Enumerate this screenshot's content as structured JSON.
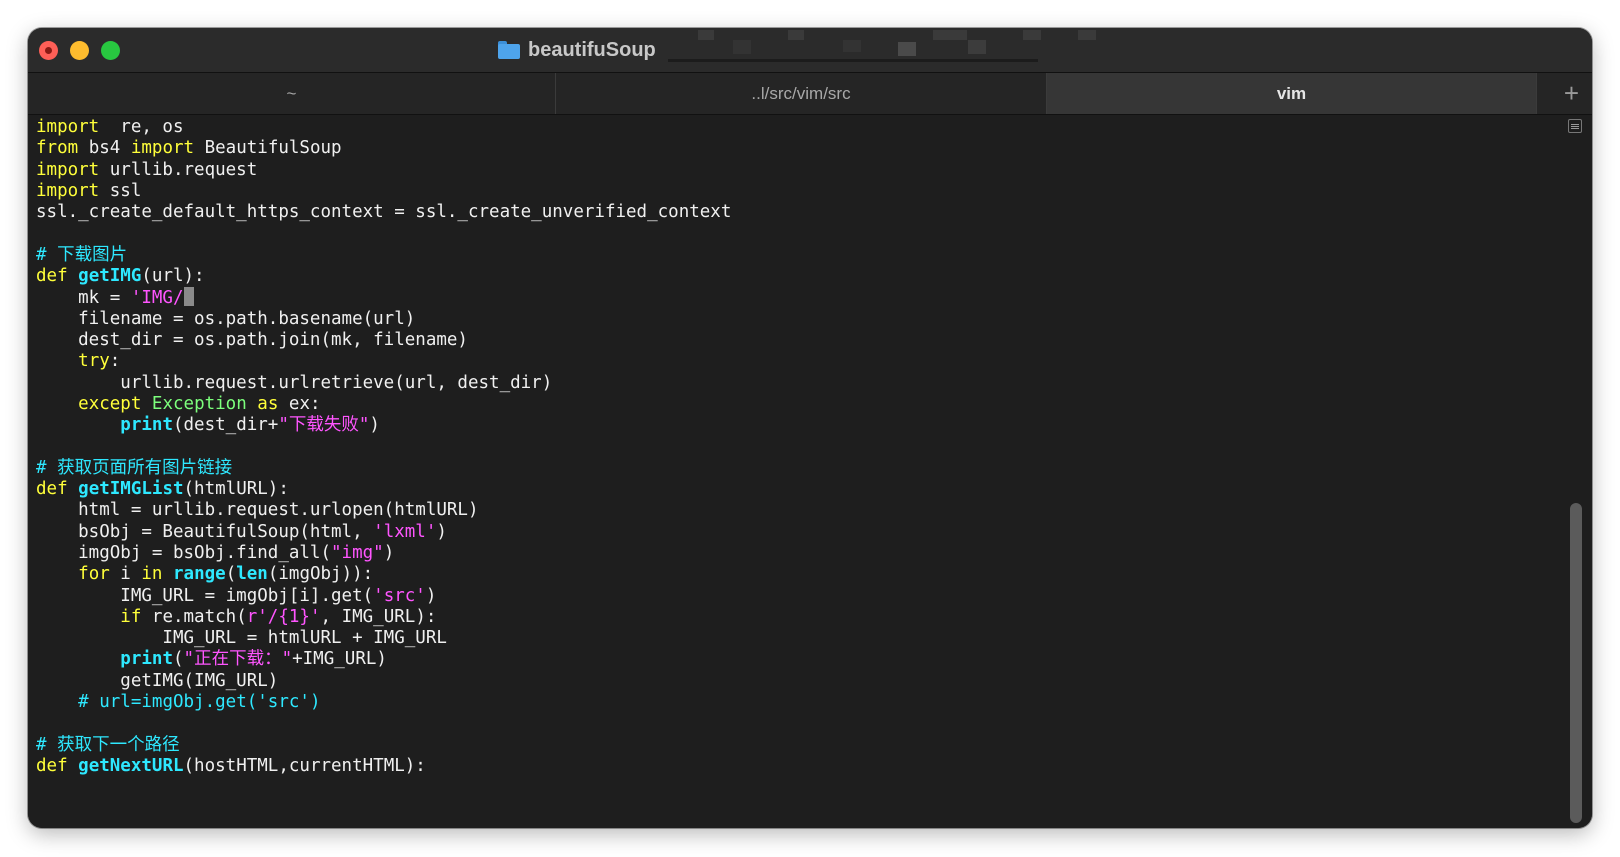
{
  "window": {
    "title": "beautifuSoup",
    "tabs": [
      {
        "label": "~",
        "active": false
      },
      {
        "label": "..l/src/vim/src",
        "active": false
      },
      {
        "label": "vim",
        "active": true
      }
    ],
    "new_tab_label": "+"
  },
  "editor": {
    "scroll_position_fraction": 0.65,
    "scroll_visible_fraction": 0.47,
    "lines": [
      [
        [
          "kw",
          "import"
        ],
        [
          "",
          "  re, os"
        ]
      ],
      [
        [
          "kw",
          "from"
        ],
        [
          "",
          " bs4 "
        ],
        [
          "kw",
          "import"
        ],
        [
          "",
          " BeautifulSoup"
        ]
      ],
      [
        [
          "kw",
          "import"
        ],
        [
          "",
          " urllib.request"
        ]
      ],
      [
        [
          "kw",
          "import"
        ],
        [
          "",
          " ssl"
        ]
      ],
      [
        [
          "",
          "ssl._create_default_https_context = ssl._create_unverified_context"
        ]
      ],
      [],
      [
        [
          "cm",
          "# 下载图片"
        ]
      ],
      [
        [
          "kw",
          "def"
        ],
        [
          "",
          " "
        ],
        [
          "fn",
          "getIMG"
        ],
        [
          "",
          "(url):"
        ]
      ],
      [
        [
          "",
          "    mk = "
        ],
        [
          "str",
          "'IMG/"
        ],
        [
          "cursor",
          ""
        ]
      ],
      [
        [
          "",
          "    filename = os.path.basename(url)"
        ]
      ],
      [
        [
          "",
          "    dest_dir = os.path.join(mk, filename)"
        ]
      ],
      [
        [
          "",
          "    "
        ],
        [
          "kw",
          "try"
        ],
        [
          "",
          ":"
        ]
      ],
      [
        [
          "",
          "        urllib.request.urlretrieve(url, dest_dir)"
        ]
      ],
      [
        [
          "",
          "    "
        ],
        [
          "kw",
          "except"
        ],
        [
          "",
          " "
        ],
        [
          "cls",
          "Exception"
        ],
        [
          "",
          " "
        ],
        [
          "kw",
          "as"
        ],
        [
          "",
          " ex:"
        ]
      ],
      [
        [
          "",
          "        "
        ],
        [
          "bi",
          "print"
        ],
        [
          "",
          "(dest_dir+"
        ],
        [
          "str",
          "\"下载失败\""
        ],
        [
          "",
          ")"
        ]
      ],
      [],
      [
        [
          "cm",
          "# 获取页面所有图片链接"
        ]
      ],
      [
        [
          "kw",
          "def"
        ],
        [
          "",
          " "
        ],
        [
          "fn",
          "getIMGList"
        ],
        [
          "",
          "(htmlURL):"
        ]
      ],
      [
        [
          "",
          "    html = urllib.request.urlopen(htmlURL)"
        ]
      ],
      [
        [
          "",
          "    bsObj = BeautifulSoup(html, "
        ],
        [
          "str",
          "'lxml'"
        ],
        [
          "",
          ")"
        ]
      ],
      [
        [
          "",
          "    imgObj = bsObj.find_all("
        ],
        [
          "str",
          "\"img\""
        ],
        [
          "",
          ")"
        ]
      ],
      [
        [
          "",
          "    "
        ],
        [
          "kw",
          "for"
        ],
        [
          "",
          " i "
        ],
        [
          "kw",
          "in"
        ],
        [
          "",
          " "
        ],
        [
          "bi",
          "range"
        ],
        [
          "",
          "("
        ],
        [
          "bi",
          "len"
        ],
        [
          "",
          "(imgObj)):"
        ]
      ],
      [
        [
          "",
          "        IMG_URL = imgObj[i].get("
        ],
        [
          "str",
          "'src'"
        ],
        [
          "",
          ")"
        ]
      ],
      [
        [
          "",
          "        "
        ],
        [
          "kw",
          "if"
        ],
        [
          "",
          " re.match("
        ],
        [
          "str",
          "r'/{1}'"
        ],
        [
          "",
          ", IMG_URL):"
        ]
      ],
      [
        [
          "",
          "            IMG_URL = htmlURL + IMG_URL"
        ]
      ],
      [
        [
          "",
          "        "
        ],
        [
          "bi",
          "print"
        ],
        [
          "",
          "("
        ],
        [
          "str",
          "\"正在下载：\""
        ],
        [
          "",
          "+IMG_URL)"
        ]
      ],
      [
        [
          "",
          "        getIMG(IMG_URL)"
        ]
      ],
      [
        [
          "",
          "    "
        ],
        [
          "cm",
          "# url=imgObj.get('src')"
        ]
      ],
      [],
      [
        [
          "cm",
          "# 获取下一个路径"
        ]
      ],
      [
        [
          "kw",
          "def"
        ],
        [
          "",
          " "
        ],
        [
          "fn",
          "getNextURL"
        ],
        [
          "",
          "(hostHTML,currentHTML):"
        ]
      ]
    ]
  }
}
